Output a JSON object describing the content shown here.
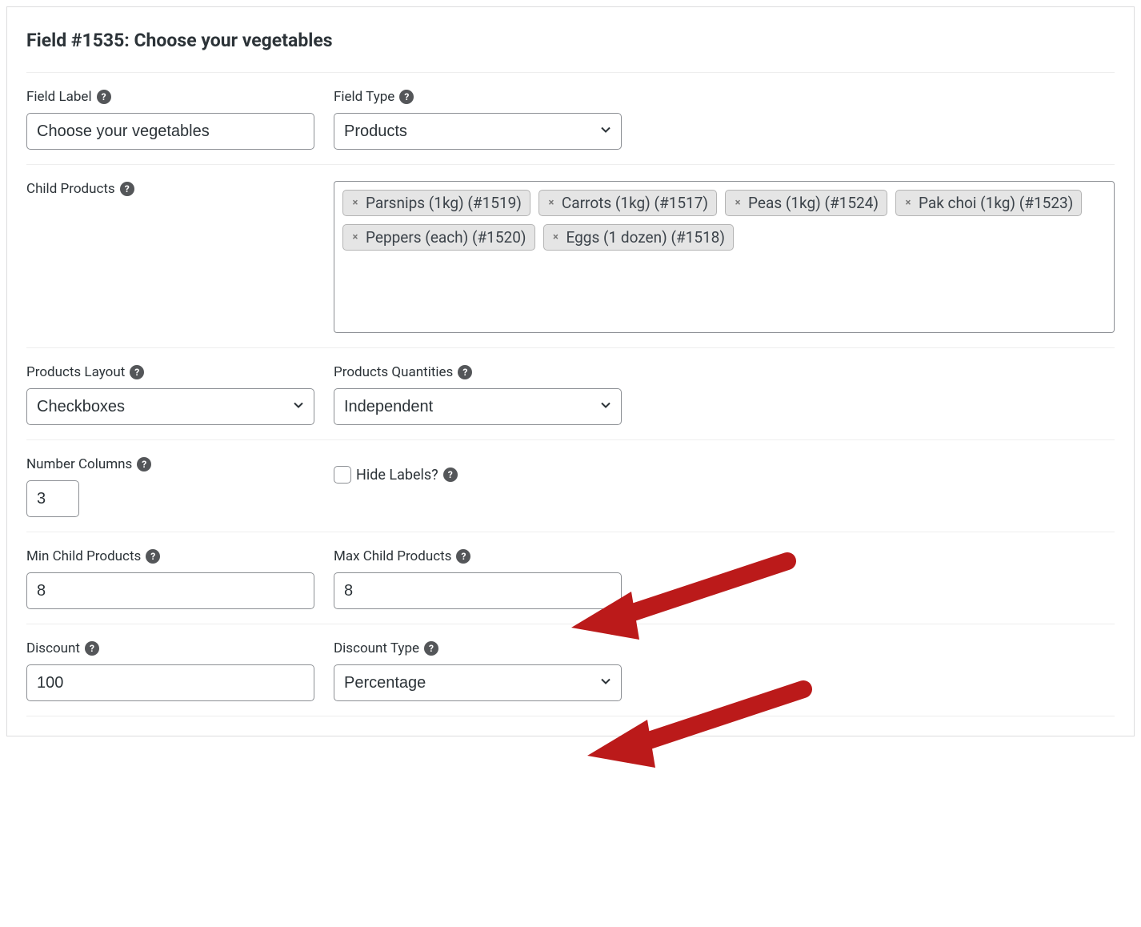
{
  "panel_title": "Field #1535: Choose your vegetables",
  "field_label": {
    "label": "Field Label",
    "value": "Choose your vegetables"
  },
  "field_type": {
    "label": "Field Type",
    "value": "Products"
  },
  "child_products": {
    "label": "Child Products",
    "tags": [
      "Parsnips (1kg) (#1519)",
      "Carrots (1kg) (#1517)",
      "Peas (1kg) (#1524)",
      "Pak choi (1kg) (#1523)",
      "Peppers (each) (#1520)",
      "Eggs (1 dozen) (#1518)"
    ]
  },
  "products_layout": {
    "label": "Products Layout",
    "value": "Checkboxes"
  },
  "products_quantities": {
    "label": "Products Quantities",
    "value": "Independent"
  },
  "number_columns": {
    "label": "Number Columns",
    "value": "3"
  },
  "hide_labels": {
    "label": "Hide Labels?",
    "checked": false
  },
  "min_child": {
    "label": "Min Child Products",
    "value": "8"
  },
  "max_child": {
    "label": "Max Child Products",
    "value": "8"
  },
  "discount": {
    "label": "Discount",
    "value": "100"
  },
  "discount_type": {
    "label": "Discount Type",
    "value": "Percentage"
  }
}
